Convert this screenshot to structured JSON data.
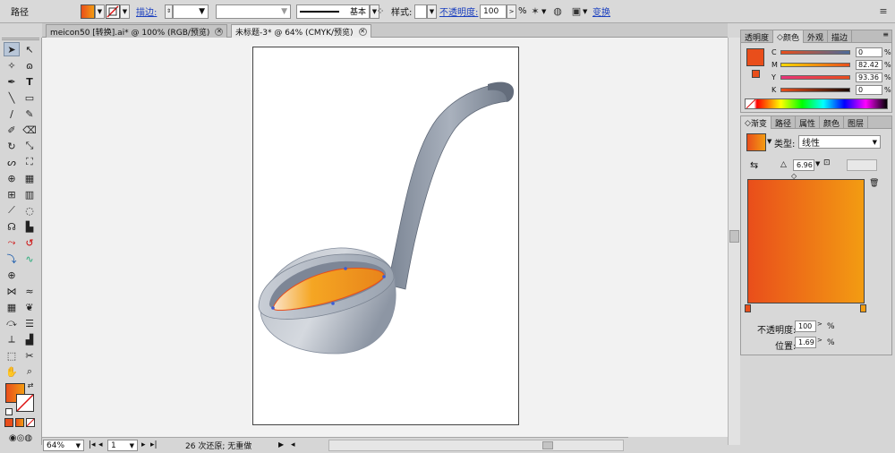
{
  "control_bar": {
    "object_type": "路径",
    "stroke_label": "描边:",
    "stroke_profile": "基本",
    "style_label": "样式:",
    "opacity_label": "不透明度:",
    "opacity_value": "100",
    "opacity_unit": "%",
    "transform_label": "变换"
  },
  "tabs": [
    {
      "label": "meicon50 [转换].ai* @ 100% (RGB/预览)",
      "close": "✕"
    },
    {
      "label": "未标题-3* @ 64% (CMYK/预览)",
      "close": "✕"
    }
  ],
  "status": {
    "zoom": "64%",
    "page": "1",
    "undo_text": "26 次还原; 无重做"
  },
  "color_panel": {
    "tabs": [
      "透明度",
      "颜色",
      "外观",
      "描边"
    ],
    "active_tab": "颜色",
    "channels": [
      {
        "label": "C",
        "value": "0"
      },
      {
        "label": "M",
        "value": "82.42"
      },
      {
        "label": "Y",
        "value": "93.36"
      },
      {
        "label": "K",
        "value": "0"
      }
    ],
    "fill_color": "#e94e1b"
  },
  "gradient_panel": {
    "tabs": [
      "渐变",
      "路径",
      "属性",
      "颜色",
      "图层"
    ],
    "active_tab": "渐变",
    "type_label": "类型:",
    "type_value": "线性",
    "angle_value": "6.96",
    "opacity_label": "不透明度:",
    "opacity_value": "100",
    "location_label": "位置:",
    "location_value": "1.69",
    "pct": "%",
    "stop_colors": [
      "#e94e1b",
      "#f39c12"
    ]
  },
  "artwork": {
    "ladle_handle_color": "#8e97a6",
    "ladle_bowl_color": "#c3c8cf",
    "liquid_colors": [
      "#e94e1b",
      "#f5a623"
    ]
  }
}
